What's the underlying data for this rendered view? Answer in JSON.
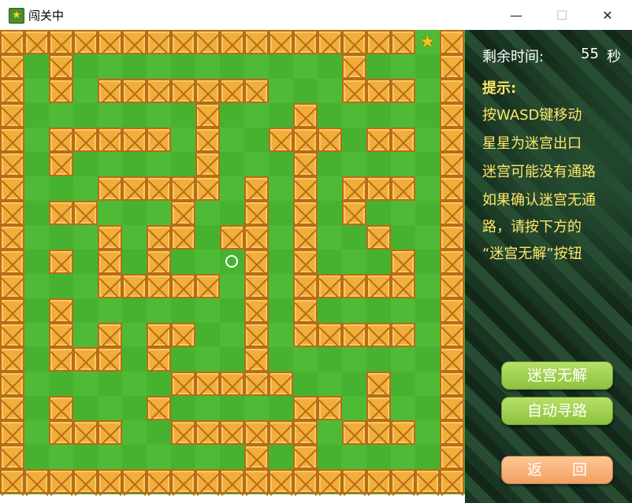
{
  "window": {
    "title": "闯关中",
    "minimize": "—",
    "maximize": "☐",
    "close": "✕"
  },
  "status": {
    "time_label": "剩余时间:",
    "time_value": "55",
    "time_unit": "秒"
  },
  "hints": {
    "title": "提示:",
    "lines": [
      "按WASD键移动",
      "星星为迷宫出口",
      "迷宫可能没有通路",
      "如果确认迷宫无通",
      "路，请按下方的",
      "“迷宫无解”按钮"
    ]
  },
  "buttons": {
    "no_solution": "迷宫无解",
    "auto_path": "自动寻路",
    "back": "返　　回"
  },
  "maze": {
    "goal_icon": "star-icon",
    "rows": [
      "1111111111111111101",
      "1010000000000010001",
      "1010111111100011101",
      "1000000010001000001",
      "1011111010011101101",
      "1010000010001000001",
      "1000111110101011101",
      "1011000100101010001",
      "1000101101101001001",
      "1010101000101000101",
      "1000111110101111101",
      "1010000000101000001",
      "1010101100101111101",
      "1011101000100000001",
      "1000000111110001001",
      "1010001000001101001",
      "1011100111111011101",
      "1000000000101000001",
      "1111111111111111111"
    ]
  }
}
